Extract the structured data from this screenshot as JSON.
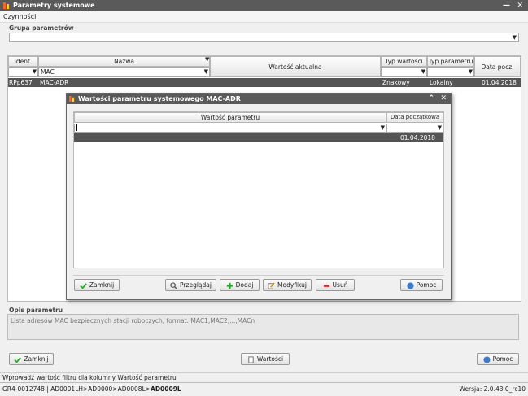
{
  "window": {
    "title": "Parametry systemowe"
  },
  "menu": {
    "item1": "Czynności"
  },
  "group": {
    "label": "Grupa parametrów",
    "value": ""
  },
  "table": {
    "headers": {
      "ident": "Ident.",
      "name": "Nazwa",
      "current_value": "Wartość aktualna",
      "value_type": "Typ wartości",
      "param_type": "Typ parametru",
      "start_date": "Data pocz."
    },
    "filter_name": "MAC",
    "row": {
      "ident": "RPp637",
      "name": "MAC-ADR",
      "current_value": "",
      "value_type": "Znakowy",
      "param_type": "Lokalny",
      "start_date": "01.04.2018"
    }
  },
  "dialog": {
    "title": "Wartości parametru systemowego MAC-ADR",
    "headers": {
      "value": "Wartość parametru",
      "start_date": "Data początkowa"
    },
    "row": {
      "value": "",
      "start_date": "01.04.2018"
    },
    "buttons": {
      "close": "Zamknij",
      "browse": "Przeglądaj",
      "add": "Dodaj",
      "modify": "Modyfikuj",
      "delete": "Usuń",
      "help": "Pomoc"
    }
  },
  "description": {
    "label": "Opis parametru",
    "text": "Lista adresów MAC bezpiecznych stacji roboczych, format: MAC1,MAC2,...,MACn"
  },
  "bottom_buttons": {
    "close": "Zamknij",
    "values": "Wartości",
    "help": "Pomoc"
  },
  "status": {
    "hint": "Wprowadź wartość filtru dla kolumny Wartość parametru",
    "path_prefix": "GR4-0012748 | AD0001LH>AD0000>AD0008L>",
    "path_current": "AD0009L",
    "version": "Wersja: 2.0.43.0_rc10"
  }
}
